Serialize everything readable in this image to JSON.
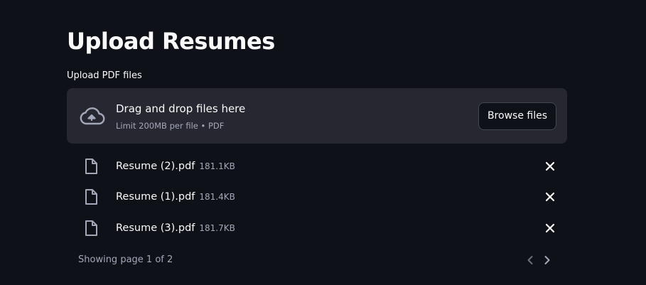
{
  "page": {
    "title": "Upload Resumes"
  },
  "uploader": {
    "label": "Upload PDF files",
    "dropzone_text": "Drag and drop files here",
    "limit_text": "Limit 200MB per file • PDF",
    "browse_label": "Browse files",
    "icon": "cloud-upload-icon"
  },
  "files": [
    {
      "name": "Resume (2).pdf",
      "size": "181.1KB"
    },
    {
      "name": "Resume (1).pdf",
      "size": "181.4KB"
    },
    {
      "name": "Resume (3).pdf",
      "size": "181.7KB"
    }
  ],
  "pagination": {
    "text": "Showing page 1 of 2"
  },
  "colors": {
    "background": "#0e1117",
    "dropzone": "#262730",
    "text": "#fafafa",
    "muted_text": "#a3a8b8"
  }
}
